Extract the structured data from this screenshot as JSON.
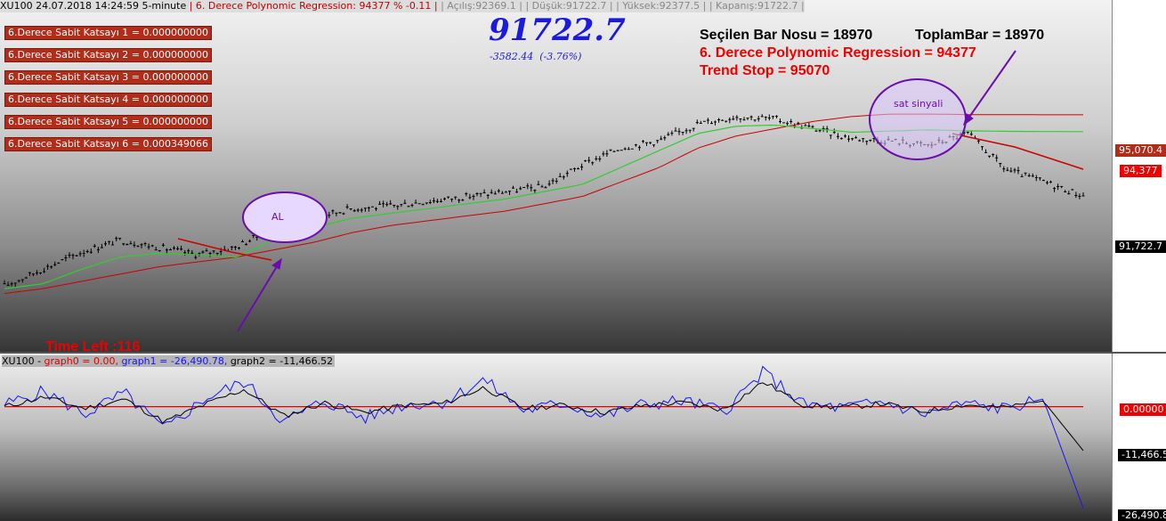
{
  "header": {
    "symbol_info": "XU100 24.07.2018 14:24:59 5-minute",
    "regression_info": "| 6. Derece Polynomic Regression: 94377 % -0.11 |",
    "open": "| Açılış:92369.1 |",
    "low": "| Düşük:91722.7 |",
    "high": "| Yüksek:92377.5 |",
    "close": "| Kapanış:91722.7 |"
  },
  "coefficients": [
    "6.Derece Sabit Katsayı 1 =  0.000000000",
    "6.Derece Sabit Katsayı 2 =  0.000000000",
    "6.Derece Sabit Katsayı 3 =  0.000000000",
    "6.Derece Sabit Katsayı 4 =  0.000000000",
    "6.Derece Sabit Katsayı 5 =  0.000000000",
    "6.Derece Sabit Katsayı 6 =  0.000349066"
  ],
  "big_price": "91722.7",
  "big_change": "-3582.44  (-3.76%)",
  "info": {
    "selected_bar": "Seçilen Bar Nosu = 18970",
    "total_bar": "ToplamBar = 18970",
    "regression": "6. Derece Polynomic Regression = 94377",
    "trend_stop": "Trend Stop = 95070"
  },
  "time_left": "Time Left :116",
  "annotations": {
    "buy": "AL",
    "sell": "sat sinyali"
  },
  "price_axis": {
    "trend_stop": "95,070.4",
    "regression": "94,377",
    "last": "91,722.7"
  },
  "sub_legend": {
    "prefix": "XU100 - ",
    "graph0": "graph0 = 0.00,",
    "graph1": "graph1 = -26,490.78,",
    "graph2": "graph2 = -11,466.52"
  },
  "sub_axis": {
    "zero": "0.00000",
    "graph2": "-11,466.5",
    "graph1": "-26,490.8"
  },
  "colors": {
    "price_bars": "#000000",
    "trend_stop": "#cc0000",
    "regression_line": "#33cc33",
    "annotation": "#6a0dad",
    "graph0": "#e00000",
    "graph1": "#1515ff",
    "graph2": "#000000"
  },
  "chart_data": [
    {
      "type": "line",
      "name": "price",
      "series": [
        {
          "name": "close",
          "x": [
            0,
            1000,
            2000,
            2500,
            3000,
            3800,
            4800,
            5600,
            6200,
            7000,
            8000,
            9000,
            10000,
            11000,
            12000,
            12800,
            13600,
            14200,
            15000,
            15800,
            16600,
            17200,
            17800,
            18200,
            18600,
            18800,
            18900,
            18950,
            18970
          ],
          "values": [
            88000,
            88700,
            89400,
            89900,
            89600,
            89300,
            89600,
            90400,
            90800,
            91200,
            91300,
            91500,
            91700,
            91900,
            92100,
            93000,
            93700,
            94000,
            94700,
            95000,
            94900,
            94500,
            94100,
            94000,
            93800,
            94300,
            92800,
            92300,
            91722.7
          ]
        },
        {
          "name": "6. Derece Polynomic Regression",
          "values": [
            87900,
            88100,
            88700,
            89200,
            89350,
            89300,
            89200,
            89900,
            90400,
            90800,
            91000,
            91200,
            91400,
            91600,
            91900,
            92200,
            92900,
            93600,
            94300,
            94600,
            94650,
            94500,
            94350,
            94400,
            94450,
            94410,
            94390,
            94380,
            94377
          ]
        },
        {
          "name": "Trend Stop",
          "values": [
            87700,
            87900,
            88200,
            88500,
            88800,
            89000,
            89200,
            89500,
            89800,
            90200,
            90500,
            90700,
            90900,
            91100,
            91400,
            91700,
            92300,
            92900,
            93700,
            94200,
            94500,
            94800,
            95000,
            95100,
            95100,
            95080,
            95075,
            95072,
            95070.4
          ]
        }
      ]
    },
    {
      "type": "line",
      "name": "oscillator",
      "series": [
        {
          "name": "graph0",
          "values": [
            0
          ]
        },
        {
          "name": "graph1",
          "values": [
            500,
            4000,
            -2000,
            3500,
            -6000,
            2000,
            6500,
            -4000,
            1500,
            -3000,
            500,
            1200,
            7000,
            -1000,
            800,
            -2500,
            600,
            1500,
            -1200,
            9000,
            500,
            -300,
            1200,
            -2000,
            800,
            -500,
            2000,
            -26490.78
          ]
        },
        {
          "name": "graph2",
          "values": [
            0,
            2500,
            -500,
            2000,
            -4000,
            500,
            4500,
            -2500,
            1000,
            -1500,
            300,
            800,
            5000,
            -500,
            400,
            -1500,
            300,
            1000,
            -800,
            6500,
            400,
            -200,
            800,
            -1300,
            500,
            -300,
            1500,
            -11466.52
          ]
        }
      ],
      "ylim": [
        -28000,
        12000
      ]
    }
  ]
}
